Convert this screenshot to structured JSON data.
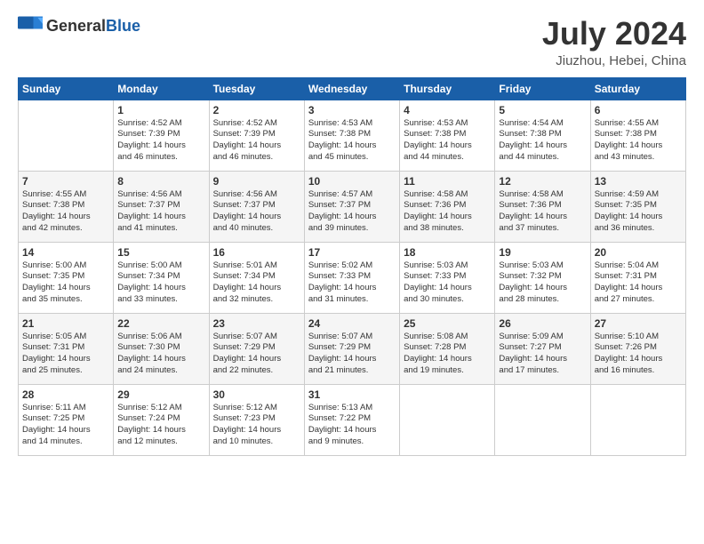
{
  "header": {
    "logo_general": "General",
    "logo_blue": "Blue",
    "title": "July 2024",
    "location": "Jiuzhou, Hebei, China"
  },
  "days_of_week": [
    "Sunday",
    "Monday",
    "Tuesday",
    "Wednesday",
    "Thursday",
    "Friday",
    "Saturday"
  ],
  "weeks": [
    [
      {
        "day": "",
        "content": ""
      },
      {
        "day": "1",
        "content": "Sunrise: 4:52 AM\nSunset: 7:39 PM\nDaylight: 14 hours\nand 46 minutes."
      },
      {
        "day": "2",
        "content": "Sunrise: 4:52 AM\nSunset: 7:39 PM\nDaylight: 14 hours\nand 46 minutes."
      },
      {
        "day": "3",
        "content": "Sunrise: 4:53 AM\nSunset: 7:38 PM\nDaylight: 14 hours\nand 45 minutes."
      },
      {
        "day": "4",
        "content": "Sunrise: 4:53 AM\nSunset: 7:38 PM\nDaylight: 14 hours\nand 44 minutes."
      },
      {
        "day": "5",
        "content": "Sunrise: 4:54 AM\nSunset: 7:38 PM\nDaylight: 14 hours\nand 44 minutes."
      },
      {
        "day": "6",
        "content": "Sunrise: 4:55 AM\nSunset: 7:38 PM\nDaylight: 14 hours\nand 43 minutes."
      }
    ],
    [
      {
        "day": "7",
        "content": "Sunrise: 4:55 AM\nSunset: 7:38 PM\nDaylight: 14 hours\nand 42 minutes."
      },
      {
        "day": "8",
        "content": "Sunrise: 4:56 AM\nSunset: 7:37 PM\nDaylight: 14 hours\nand 41 minutes."
      },
      {
        "day": "9",
        "content": "Sunrise: 4:56 AM\nSunset: 7:37 PM\nDaylight: 14 hours\nand 40 minutes."
      },
      {
        "day": "10",
        "content": "Sunrise: 4:57 AM\nSunset: 7:37 PM\nDaylight: 14 hours\nand 39 minutes."
      },
      {
        "day": "11",
        "content": "Sunrise: 4:58 AM\nSunset: 7:36 PM\nDaylight: 14 hours\nand 38 minutes."
      },
      {
        "day": "12",
        "content": "Sunrise: 4:58 AM\nSunset: 7:36 PM\nDaylight: 14 hours\nand 37 minutes."
      },
      {
        "day": "13",
        "content": "Sunrise: 4:59 AM\nSunset: 7:35 PM\nDaylight: 14 hours\nand 36 minutes."
      }
    ],
    [
      {
        "day": "14",
        "content": "Sunrise: 5:00 AM\nSunset: 7:35 PM\nDaylight: 14 hours\nand 35 minutes."
      },
      {
        "day": "15",
        "content": "Sunrise: 5:00 AM\nSunset: 7:34 PM\nDaylight: 14 hours\nand 33 minutes."
      },
      {
        "day": "16",
        "content": "Sunrise: 5:01 AM\nSunset: 7:34 PM\nDaylight: 14 hours\nand 32 minutes."
      },
      {
        "day": "17",
        "content": "Sunrise: 5:02 AM\nSunset: 7:33 PM\nDaylight: 14 hours\nand 31 minutes."
      },
      {
        "day": "18",
        "content": "Sunrise: 5:03 AM\nSunset: 7:33 PM\nDaylight: 14 hours\nand 30 minutes."
      },
      {
        "day": "19",
        "content": "Sunrise: 5:03 AM\nSunset: 7:32 PM\nDaylight: 14 hours\nand 28 minutes."
      },
      {
        "day": "20",
        "content": "Sunrise: 5:04 AM\nSunset: 7:31 PM\nDaylight: 14 hours\nand 27 minutes."
      }
    ],
    [
      {
        "day": "21",
        "content": "Sunrise: 5:05 AM\nSunset: 7:31 PM\nDaylight: 14 hours\nand 25 minutes."
      },
      {
        "day": "22",
        "content": "Sunrise: 5:06 AM\nSunset: 7:30 PM\nDaylight: 14 hours\nand 24 minutes."
      },
      {
        "day": "23",
        "content": "Sunrise: 5:07 AM\nSunset: 7:29 PM\nDaylight: 14 hours\nand 22 minutes."
      },
      {
        "day": "24",
        "content": "Sunrise: 5:07 AM\nSunset: 7:29 PM\nDaylight: 14 hours\nand 21 minutes."
      },
      {
        "day": "25",
        "content": "Sunrise: 5:08 AM\nSunset: 7:28 PM\nDaylight: 14 hours\nand 19 minutes."
      },
      {
        "day": "26",
        "content": "Sunrise: 5:09 AM\nSunset: 7:27 PM\nDaylight: 14 hours\nand 17 minutes."
      },
      {
        "day": "27",
        "content": "Sunrise: 5:10 AM\nSunset: 7:26 PM\nDaylight: 14 hours\nand 16 minutes."
      }
    ],
    [
      {
        "day": "28",
        "content": "Sunrise: 5:11 AM\nSunset: 7:25 PM\nDaylight: 14 hours\nand 14 minutes."
      },
      {
        "day": "29",
        "content": "Sunrise: 5:12 AM\nSunset: 7:24 PM\nDaylight: 14 hours\nand 12 minutes."
      },
      {
        "day": "30",
        "content": "Sunrise: 5:12 AM\nSunset: 7:23 PM\nDaylight: 14 hours\nand 10 minutes."
      },
      {
        "day": "31",
        "content": "Sunrise: 5:13 AM\nSunset: 7:22 PM\nDaylight: 14 hours\nand 9 minutes."
      },
      {
        "day": "",
        "content": ""
      },
      {
        "day": "",
        "content": ""
      },
      {
        "day": "",
        "content": ""
      }
    ]
  ]
}
